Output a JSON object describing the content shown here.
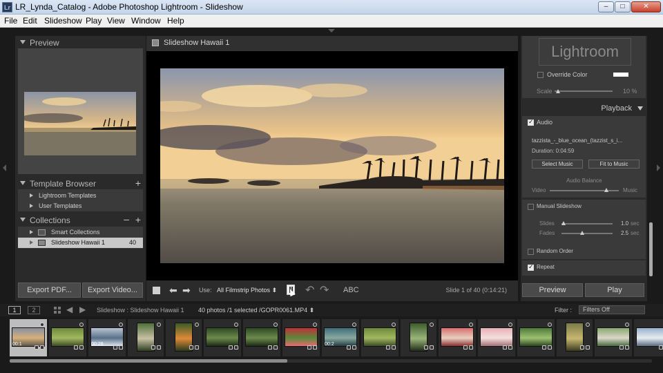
{
  "window": {
    "title": "LR_Lynda_Catalog - Adobe Photoshop Lightroom - Slideshow",
    "app_icon": "Lr",
    "buttons": {
      "minimize": "–",
      "maximize": "□",
      "close": "✕"
    }
  },
  "menu": [
    "File",
    "Edit",
    "Slideshow",
    "Play",
    "View",
    "Window",
    "Help"
  ],
  "left_panel": {
    "preview_header": "Preview",
    "template_browser": {
      "header": "Template Browser",
      "items": [
        "Lightroom Templates",
        "User Templates"
      ]
    },
    "collections": {
      "header": "Collections",
      "items": [
        {
          "label": "Smart Collections"
        },
        {
          "label": "Slideshow Hawaii 1",
          "count": "40"
        }
      ]
    },
    "export_pdf": "Export PDF...",
    "export_video": "Export Video..."
  },
  "center": {
    "title": "Slideshow Hawaii 1",
    "toolbar": {
      "use_label": "Use:",
      "use_value": "All Filmstrip Photos ⬍",
      "abc": "ABC",
      "status": "Slide 1 of 40 (0:14:21)"
    }
  },
  "right_panel": {
    "identity_plate": "Lightroom",
    "override_color": "Override Color",
    "scale_label": "Scale",
    "scale_value": "10 %",
    "playback_header": "Playback",
    "audio_label": "Audio",
    "track_name": "tazzista_-_blue_ocean_(tazzist_s_i...",
    "duration": "Duration: 0:04:59",
    "select_music": "Select Music",
    "fit_to_music": "Fit to Music",
    "audio_balance": "Audio Balance",
    "balance_left": "Video",
    "balance_right": "Music",
    "audio_balance_level": 0.82,
    "manual_slideshow": "Manual Slideshow",
    "slides_label": "Slides",
    "slides_value": "1.0",
    "fades_label": "Fades",
    "fades_value": "2.5",
    "unit": "sec",
    "random_order": "Random Order",
    "repeat": "Repeat",
    "preview_btn": "Preview",
    "play_btn": "Play"
  },
  "filmstrip_bar": {
    "screen1": "1",
    "screen2": "2",
    "path": "Slideshow : Slideshow Hawaii 1",
    "selection": "40 photos /1 selected /GOPR0061.MP4 ⬍",
    "filter_label": "Filter :",
    "filter_value": "Filters Off"
  },
  "filmstrip": {
    "thumbs": [
      {
        "kind": "sunset",
        "label": "00:1"
      },
      {
        "kind": "green"
      },
      {
        "kind": "aerial",
        "label": "00:28"
      },
      {
        "kind": "portrait-green"
      },
      {
        "kind": "portrait-orange"
      },
      {
        "kind": "forest"
      },
      {
        "kind": "forest"
      },
      {
        "kind": "red-flower"
      },
      {
        "kind": "teal",
        "label": "00:2"
      },
      {
        "kind": "green"
      },
      {
        "kind": "portrait-forest"
      },
      {
        "kind": "kid-red"
      },
      {
        "kind": "kid-pink"
      },
      {
        "kind": "plant"
      },
      {
        "kind": "portrait-pineapple"
      },
      {
        "kind": "beach"
      },
      {
        "kind": "sky"
      }
    ]
  }
}
